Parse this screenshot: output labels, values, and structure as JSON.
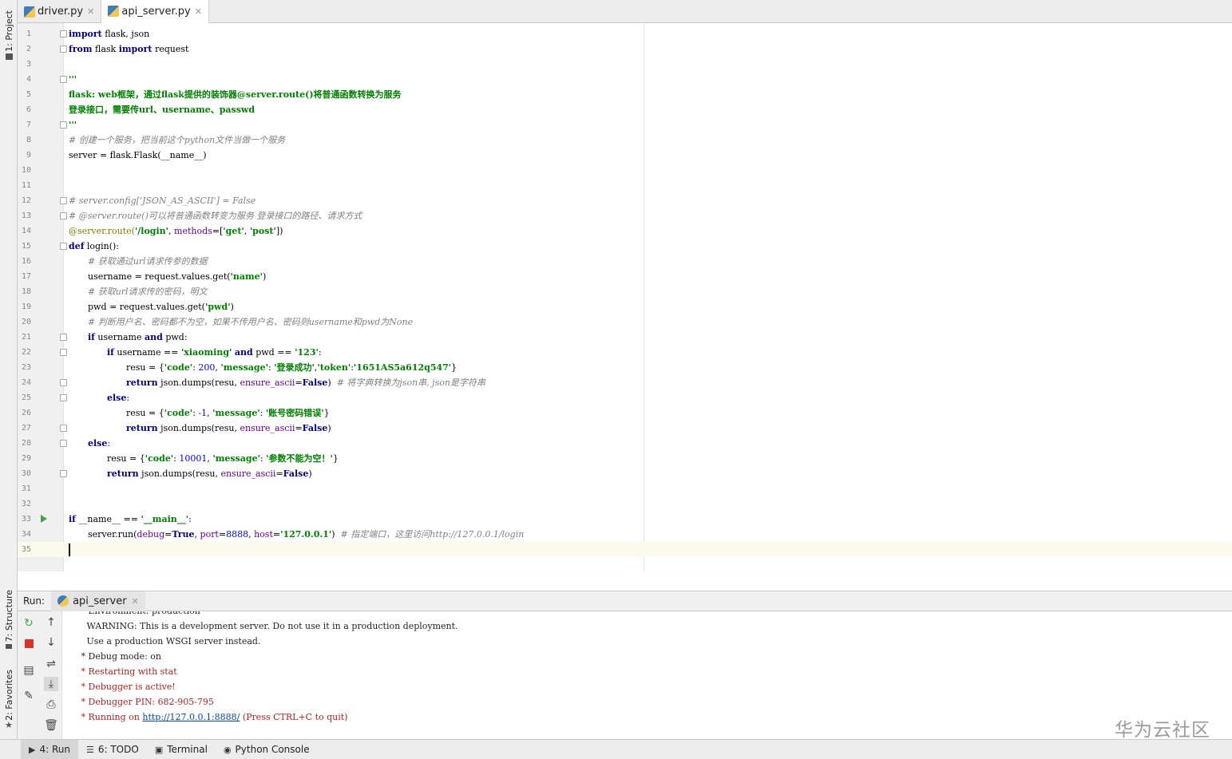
{
  "side_tabs": {
    "project": "1: Project",
    "structure": "7: Structure",
    "favorites": "2: Favorites"
  },
  "editor_tabs": [
    {
      "label": "driver.py"
    },
    {
      "label": "api_server.py"
    }
  ],
  "code_lines": [
    "1",
    "2",
    "3",
    "4",
    "5",
    "6",
    "7",
    "8",
    "9",
    "10",
    "11",
    "12",
    "13",
    "14",
    "15",
    "16",
    "17",
    "18",
    "19",
    "20",
    "21",
    "22",
    "23",
    "24",
    "25",
    "26",
    "27",
    "28",
    "29",
    "30",
    "31",
    "32",
    "33",
    "34",
    "35"
  ],
  "code": {
    "l1a": "import",
    "l1b": " flask, json",
    "l2a": "from",
    "l2b": " flask ",
    "l2c": "import",
    "l2d": " request",
    "l4": "'''",
    "l5": "flask: web框架，通过flask提供的装饰器@server.route()将普通函数转换为服务",
    "l6": "登录接口，需要传url、username、passwd",
    "l7": "'''",
    "l8": "# 创建一个服务，把当前这个python文件当做一个服务",
    "l9": "server = flask.Flask(__name__)",
    "l12": "# server.config['JSON_AS_ASCII'] = False",
    "l13": "# @server.route()可以将普通函数转变为服务 登录接口的路径、请求方式",
    "l14a": "@server.route(",
    "l14b": "'/login'",
    "l14c": ", ",
    "l14d": "methods",
    "l14e": "=[",
    "l14f": "'get'",
    "l14g": ", ",
    "l14h": "'post'",
    "l14i": "])",
    "l15a": "def",
    "l15b": " login():",
    "l16": "# 获取通过url请求传参的数据",
    "l17a": "username = request.values.get(",
    "l17b": "'name'",
    "l17c": ")",
    "l18": "# 获取url请求传的密码，明文",
    "l19a": "pwd = request.values.get(",
    "l19b": "'pwd'",
    "l19c": ")",
    "l20": "# 判断用户名、密码都不为空，如果不传用户名、密码则username和pwd为None",
    "l21a": "if",
    "l21b": " username ",
    "l21c": "and",
    "l21d": " pwd:",
    "l22a": "if",
    "l22b": " username == ",
    "l22c": "'xiaoming'",
    "l22d": " ",
    "l22e": "and",
    "l22f": " pwd == ",
    "l22g": "'123'",
    "l22h": ":",
    "l23a": "resu = {",
    "l23b": "'code'",
    "l23c": ": ",
    "l23d": "200",
    "l23e": ", ",
    "l23f": "'message'",
    "l23g": ": ",
    "l23h": "'登录成功'",
    "l23i": ",",
    "l23j": "'token'",
    "l23k": ":",
    "l23l": "'1651AS5a612q547'",
    "l23m": "}",
    "l24a": "return",
    "l24b": " json.dumps(resu, ",
    "l24c": "ensure_ascii",
    "l24d": "=",
    "l24e": "False",
    "l24f": ")  ",
    "l24g": "# 将字典转换为json串, json是字符串",
    "l25": "else",
    "l26a": "resu = {",
    "l26b": "'code'",
    "l26c": ": ",
    "l26d": "-1",
    "l26e": ", ",
    "l26f": "'message'",
    "l26g": ": ",
    "l26h": "'账号密码错误'",
    "l26i": "}",
    "l27a": "return",
    "l27b": " json.dumps(resu, ",
    "l27c": "ensure_ascii",
    "l27d": "=",
    "l27e": "False",
    "l27f": ")",
    "l28": "else",
    "l29a": "resu = {",
    "l29b": "'code'",
    "l29c": ": ",
    "l29d": "10001",
    "l29e": ", ",
    "l29f": "'message'",
    "l29g": ": ",
    "l29h": "'参数不能为空！'",
    "l29i": "}",
    "l30a": "return",
    "l30b": " json.dumps(resu, ",
    "l30c": "ensure_ascii",
    "l30d": "=",
    "l30e": "False",
    "l30f": ")",
    "l33a": "if",
    "l33b": " __name__ == ",
    "l33c": "'__main__'",
    "l33d": ":",
    "l34a": "server.run(",
    "l34b": "debug",
    "l34c": "=",
    "l34d": "True",
    "l34e": ", ",
    "l34f": "port",
    "l34g": "=",
    "l34h": "8888",
    "l34i": ", ",
    "l34j": "host",
    "l34k": "=",
    "l34l": "'127.0.0.1'",
    "l34m": ")  ",
    "l34n": "# 指定端口，这里访问http://127.0.0.1/login"
  },
  "run": {
    "label": "Run:",
    "tab": "api_server"
  },
  "console": {
    "line0": " * Environment: production",
    "line1": "   WARNING: This is a development server. Do not use it in a production deployment.",
    "line2": "   Use a production WSGI server instead.",
    "line3": " * Debug mode: on",
    "line4": " * Restarting with stat",
    "line5": " * Debugger is active!",
    "line6": " * Debugger PIN: 682-905-795",
    "line7a": " * Running on ",
    "line7b": "http://127.0.0.1:8888/",
    "line7c": " (Press CTRL+C to quit)"
  },
  "status_tabs": {
    "run": "4: Run",
    "todo": "6: TODO",
    "terminal": "Terminal",
    "python_console": "Python Console"
  },
  "watermark": "华为云社区"
}
